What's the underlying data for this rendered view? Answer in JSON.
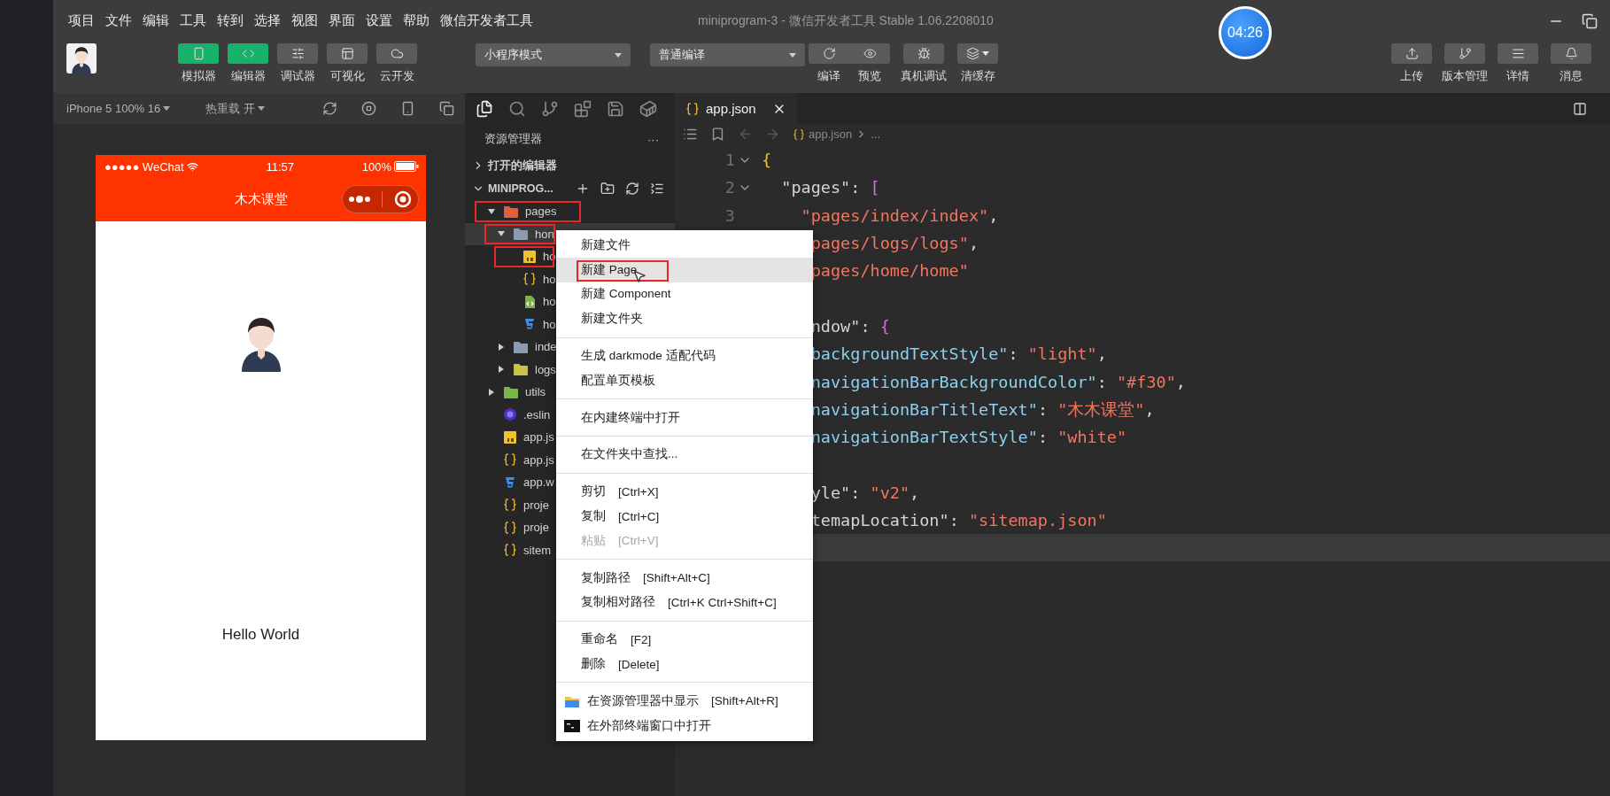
{
  "window": {
    "menu": [
      "项目",
      "文件",
      "编辑",
      "工具",
      "转到",
      "选择",
      "视图",
      "界面",
      "设置",
      "帮助",
      "微信开发者工具"
    ],
    "title": "miniprogram-3 - 微信开发者工具 Stable 1.06.2208010",
    "timer": "04:26"
  },
  "toolbar": {
    "views": [
      {
        "label": "模拟器",
        "kind": "phone",
        "selected": true
      },
      {
        "label": "编辑器",
        "kind": "code",
        "selected": true
      },
      {
        "label": "调试器",
        "kind": "sliders",
        "selected": false
      },
      {
        "label": "可视化",
        "kind": "layout",
        "selected": false
      },
      {
        "label": "云开发",
        "kind": "cloud",
        "selected": false
      }
    ],
    "modes": [
      {
        "value": "小程序模式"
      },
      {
        "value": "普通编译"
      }
    ],
    "actions": [
      {
        "label": "编译",
        "kind": "refresh",
        "joined": false,
        "caret": false
      },
      {
        "label": "预览",
        "kind": "eye",
        "joined": true,
        "caret": false
      },
      {
        "label": "真机调试",
        "kind": "bug",
        "joined": false,
        "caret": false
      },
      {
        "label": "清缓存",
        "kind": "layers",
        "joined": false,
        "caret": true
      }
    ],
    "right": [
      {
        "label": "上传",
        "kind": "upload"
      },
      {
        "label": "版本管理",
        "kind": "branch"
      },
      {
        "label": "详情",
        "kind": "lines"
      },
      {
        "label": "消息",
        "kind": "bell"
      }
    ]
  },
  "simulator": {
    "device": "iPhone 5 100% 16",
    "hot_reload": "热重载 开",
    "phone": {
      "carrier": "●●●●● WeChat",
      "time": "11:57",
      "battery": "100%",
      "title": "木木课堂",
      "text": "Hello World"
    }
  },
  "explorer": {
    "title": "资源管理器",
    "more": "···",
    "sections": [
      {
        "label": "打开的编辑器",
        "expanded": false
      },
      {
        "label": "MINIPROG...",
        "expanded": true
      }
    ],
    "tree": [
      {
        "name": "pages",
        "kind": "pages-folder",
        "expanded": true,
        "selected": false,
        "marked": true,
        "children": [
          {
            "name": "hon",
            "kind": "folder",
            "expanded": true,
            "selected": true,
            "marked": true,
            "children": [
              {
                "name": "ho",
                "kind": "js",
                "selected": false,
                "marked": true
              },
              {
                "name": "ho",
                "kind": "json",
                "selected": false,
                "marked": false
              },
              {
                "name": "ho",
                "kind": "wxml",
                "selected": false,
                "marked": false
              },
              {
                "name": "ho",
                "kind": "wxss",
                "selected": false,
                "marked": false
              }
            ]
          },
          {
            "name": "inde",
            "kind": "folder",
            "expanded": false,
            "selected": false,
            "marked": false
          },
          {
            "name": "logs",
            "kind": "logs-folder",
            "expanded": false,
            "selected": false,
            "marked": false
          }
        ]
      },
      {
        "name": "utils",
        "kind": "utils-folder",
        "expanded": false,
        "selected": false,
        "marked": false
      },
      {
        "name": ".eslin",
        "kind": "eslint",
        "selected": false,
        "marked": false
      },
      {
        "name": "app.js",
        "kind": "js",
        "selected": false,
        "marked": false
      },
      {
        "name": "app.js",
        "kind": "json",
        "selected": false,
        "marked": false
      },
      {
        "name": "app.w",
        "kind": "wxss",
        "selected": false,
        "marked": false
      },
      {
        "name": "proje",
        "kind": "json",
        "selected": false,
        "marked": false
      },
      {
        "name": "proje",
        "kind": "json",
        "selected": false,
        "marked": false
      },
      {
        "name": "sitem",
        "kind": "json",
        "selected": false,
        "marked": false
      }
    ]
  },
  "editor": {
    "tab": "app.json",
    "breadcrumb": {
      "file": "app.json",
      "rest": "..."
    },
    "lines": [
      {
        "kind": "code",
        "number": "1",
        "fold": true,
        "current": false,
        "tokens": [
          {
            "kind": "brace",
            "text": "{"
          }
        ]
      },
      {
        "kind": "code",
        "number": "2",
        "fold": true,
        "current": false,
        "tokens": [
          {
            "kind": "name",
            "text": "  \"pages\""
          },
          {
            "kind": "punct",
            "text": ": "
          },
          {
            "kind": "bracket",
            "text": "["
          }
        ]
      },
      {
        "kind": "code",
        "number": "3",
        "fold": false,
        "current": false,
        "tokens": [
          {
            "kind": "string",
            "text": "    \"pages/index/index\""
          },
          {
            "kind": "punct",
            "text": ","
          }
        ]
      },
      {
        "kind": "code",
        "current": false,
        "tokens": [
          {
            "kind": "string",
            "text": "     pages/logs/logs\""
          },
          {
            "kind": "punct",
            "text": ","
          }
        ]
      },
      {
        "kind": "code",
        "current": false,
        "tokens": [
          {
            "kind": "string",
            "text": "     pages/home/home\""
          }
        ]
      },
      {
        "kind": "blank",
        "current": false
      },
      {
        "kind": "code",
        "current": false,
        "tokens": [
          {
            "kind": "name",
            "text": "     ndow\""
          },
          {
            "kind": "punct",
            "text": ": "
          },
          {
            "kind": "bracket",
            "text": "{"
          }
        ]
      },
      {
        "kind": "code",
        "current": false,
        "tokens": [
          {
            "kind": "key",
            "text": "     backgroundTextStyle\""
          },
          {
            "kind": "punct",
            "text": ": "
          },
          {
            "kind": "string",
            "text": "\"light\""
          },
          {
            "kind": "punct",
            "text": ","
          }
        ]
      },
      {
        "kind": "code",
        "current": false,
        "tokens": [
          {
            "kind": "key",
            "text": "     navigationBarBackgroundColor\""
          },
          {
            "kind": "punct",
            "text": ": "
          },
          {
            "kind": "string",
            "text": "\"#f30\""
          },
          {
            "kind": "punct",
            "text": ","
          }
        ]
      },
      {
        "kind": "code",
        "current": false,
        "tokens": [
          {
            "kind": "key",
            "text": "     navigationBarTitleText\""
          },
          {
            "kind": "punct",
            "text": ": "
          },
          {
            "kind": "string",
            "text": "\"木木课堂\""
          },
          {
            "kind": "punct",
            "text": ","
          }
        ]
      },
      {
        "kind": "code",
        "current": false,
        "tokens": [
          {
            "kind": "key",
            "text": "     navigationBarTextStyle\""
          },
          {
            "kind": "punct",
            "text": ": "
          },
          {
            "kind": "string",
            "text": "\"white\""
          }
        ]
      },
      {
        "kind": "blank",
        "current": false
      },
      {
        "kind": "code",
        "current": false,
        "tokens": [
          {
            "kind": "name",
            "text": "     yle\""
          },
          {
            "kind": "punct",
            "text": ": "
          },
          {
            "kind": "string",
            "text": "\"v2\""
          },
          {
            "kind": "punct",
            "text": ","
          }
        ]
      },
      {
        "kind": "code",
        "current": false,
        "tokens": [
          {
            "kind": "name",
            "text": "     temapLocation\""
          },
          {
            "kind": "punct",
            "text": ": "
          },
          {
            "kind": "string",
            "text": "\"sitemap.json\""
          }
        ]
      },
      {
        "kind": "blank",
        "current": true
      }
    ]
  },
  "context_menu": {
    "groups": [
      [
        {
          "label": "新建文件",
          "selected": false,
          "disabled": false,
          "marked": false
        },
        {
          "label": "新建 Page",
          "selected": true,
          "disabled": false,
          "marked": true
        },
        {
          "label": "新建 Component",
          "selected": false,
          "disabled": false,
          "marked": false
        },
        {
          "label": "新建文件夹",
          "selected": false,
          "disabled": false,
          "marked": false
        }
      ],
      [
        {
          "label": "生成 darkmode 适配代码",
          "selected": false,
          "disabled": false,
          "marked": false
        },
        {
          "label": "配置单页模板",
          "selected": false,
          "disabled": false,
          "marked": false
        }
      ],
      [
        {
          "label": "在内建终端中打开",
          "selected": false,
          "disabled": false,
          "marked": false
        }
      ],
      [
        {
          "label": "在文件夹中查找...",
          "selected": false,
          "disabled": false,
          "marked": false
        }
      ],
      [
        {
          "label": "剪切",
          "shortcut": "[Ctrl+X]",
          "selected": false,
          "disabled": false,
          "marked": false
        },
        {
          "label": "复制",
          "shortcut": "[Ctrl+C]",
          "selected": false,
          "disabled": false,
          "marked": false
        },
        {
          "label": "粘贴",
          "shortcut": "[Ctrl+V]",
          "selected": false,
          "disabled": true,
          "marked": false
        }
      ],
      [
        {
          "label": "复制路径",
          "shortcut": "[Shift+Alt+C]",
          "selected": false,
          "disabled": false,
          "marked": false
        },
        {
          "label": "复制相对路径",
          "shortcut": "[Ctrl+K Ctrl+Shift+C]",
          "selected": false,
          "disabled": false,
          "marked": false
        }
      ],
      [
        {
          "label": "重命名",
          "shortcut": "[F2]",
          "selected": false,
          "disabled": false,
          "marked": false
        },
        {
          "label": "删除",
          "shortcut": "[Delete]",
          "selected": false,
          "disabled": false,
          "marked": false
        }
      ],
      [
        {
          "label": "在资源管理器中显示",
          "shortcut": "[Shift+Alt+R]",
          "kind": "folder",
          "selected": false,
          "disabled": false,
          "marked": false
        },
        {
          "label": "在外部终端窗口中打开",
          "kind": "terminal",
          "selected": false,
          "disabled": false,
          "marked": false
        }
      ]
    ]
  }
}
